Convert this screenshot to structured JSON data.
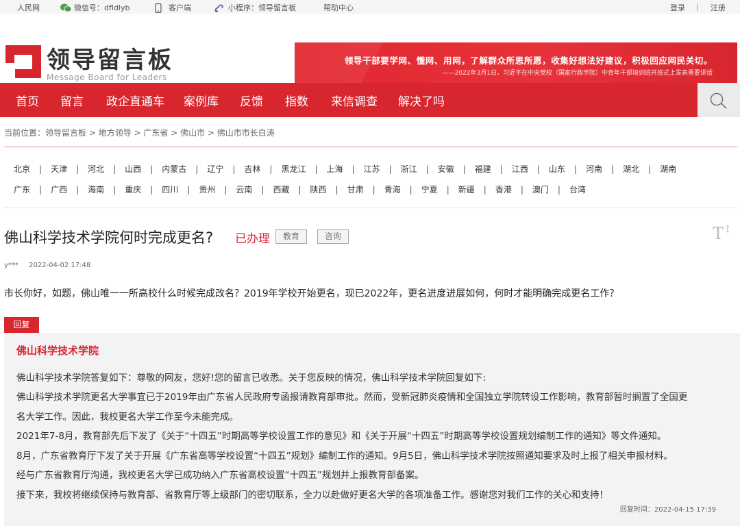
{
  "topbar": {
    "items": [
      {
        "label": "人民网",
        "icon": ""
      },
      {
        "label": "微信号：dfldlyb",
        "icon": "wechat-icon"
      },
      {
        "label": "客户端",
        "icon": "phone-icon"
      },
      {
        "label": "小程序：领导留言板",
        "icon": "miniprogram-icon"
      },
      {
        "label": "帮助中心",
        "icon": ""
      }
    ],
    "login": "登录",
    "divider": "|",
    "register": "注册"
  },
  "logo": {
    "cn": "领导留言板",
    "en": "Message Board for Leaders",
    "icon": "logo-mark"
  },
  "banner": {
    "line1": "领导干部要学网、懂网、用网，了解群众所思所愿，收集好想法好建议，积极回应网民关切。",
    "line2": "——2022年3月1日，习近平在中央党校（国家行政学院）中青年干部培训班开班式上发表重要讲话"
  },
  "nav": {
    "items": [
      "首页",
      "留言",
      "政企直通车",
      "案例库",
      "反馈",
      "指数",
      "来信调查",
      "解决了吗"
    ],
    "search_icon": "search-icon"
  },
  "breadcrumb": {
    "prefix": "当前位置：",
    "path": "领导留言板 > 地方领导 > 广东省 > 佛山市 > 佛山市市长白涛"
  },
  "provinces": {
    "row1": [
      "北京",
      "天津",
      "河北",
      "山西",
      "内蒙古",
      "辽宁",
      "吉林",
      "黑龙江",
      "上海",
      "江苏",
      "浙江",
      "安徽",
      "福建",
      "江西",
      "山东",
      "河南",
      "湖北",
      "湖南"
    ],
    "row2": [
      "广东",
      "广西",
      "海南",
      "重庆",
      "四川",
      "贵州",
      "云南",
      "西藏",
      "陕西",
      "甘肃",
      "青海",
      "宁夏",
      "新疆",
      "香港",
      "澳门",
      "台湾"
    ],
    "separator": "|"
  },
  "message": {
    "title": "佛山科学技术学院何时完成更名?",
    "status": "已办理",
    "tags": [
      "教育",
      "咨询"
    ],
    "font_size_icon": "font-size-icon",
    "author": "y***",
    "time": "2022-04-02 17:48",
    "content": "市长你好，如题，佛山唯一一所高校什么时候完成改名？2019年学校开始更名，现已2022年，更名进度进展如何，何时才能明确完成更名工作？"
  },
  "reply": {
    "tab": "回复",
    "org": "佛山科学技术学院",
    "lines": [
      "佛山科学技术学院答复如下：尊敬的网友，您好!您的留言已收悉。关于您反映的情况，佛山科学技术学院回复如下:",
      "佛山科学技术学院更名大学事宜已于2019年由广东省人民政府专函报请教育部审批。然而，受新冠肺炎疫情和全国独立学院转设工作影响，教育部暂时搁置了全国更",
      "名大学工作。因此，我校更名大学工作至今未能完成。",
      "2021年7-8月，教育部先后下发了《关于“十四五”时期高等学校设置工作的意见》和《关于开展“十四五”时期高等学校设置规划编制工作的通知》等文件通知。",
      "8月，广东省教育厅下发了关于开展《广东省高等学校设置“十四五”规划》编制工作的通知。9月5日，佛山科学技术学院按照通知要求及时上报了相关申报材料。",
      "经与广东省教育厅沟通，我校更名大学已成功纳入广东省高校设置“十四五”规划并上报教育部备案。",
      "接下来，我校将继续保持与教育部、省教育厅等上级部门的密切联系，全力以赴做好更名大学的各项准备工作。感谢您对我们工作的关心和支持！"
    ],
    "time": "回复时间：2022-04-15 17:39"
  },
  "colors": {
    "brand": "#d8262f",
    "reply_bg": "#f3f3f5",
    "topbar_bg": "#f5f5f5"
  }
}
